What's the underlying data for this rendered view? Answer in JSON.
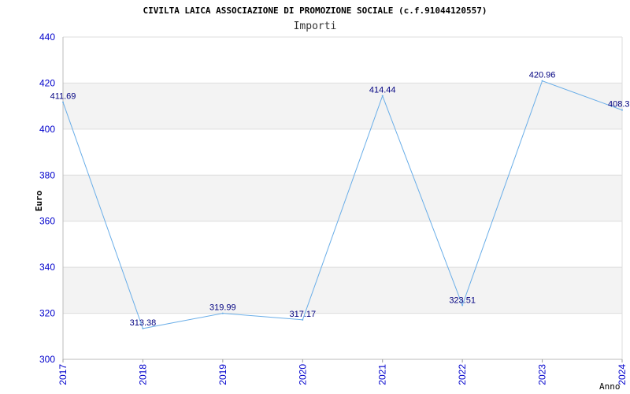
{
  "chart_data": {
    "type": "line",
    "title": "CIVILTA LAICA ASSOCIAZIONE DI PROMOZIONE SOCIALE (c.f.91044120557)",
    "subtitle": "Importi",
    "xlabel": "Anno",
    "ylabel": "Euro",
    "ylim": [
      300,
      440
    ],
    "yticks": [
      300,
      320,
      340,
      360,
      380,
      400,
      420,
      440
    ],
    "grid": true,
    "categories": [
      "2017",
      "2018",
      "2019",
      "2020",
      "2021",
      "2022",
      "2023",
      "2024"
    ],
    "series": [
      {
        "values": [
          411.69,
          313.38,
          319.99,
          317.17,
          414.44,
          323.51,
          420.96,
          408.3
        ],
        "labels": [
          "411.69",
          "313.38",
          "319.99",
          "317.17",
          "414.44",
          "323.51",
          "420.96",
          "408.3"
        ]
      }
    ],
    "colors": {
      "line": "#6aaee8",
      "band": "#f3f3f3",
      "grid": "#dddddd",
      "tick_text": "#0000cc",
      "data_label": "#000080"
    }
  }
}
